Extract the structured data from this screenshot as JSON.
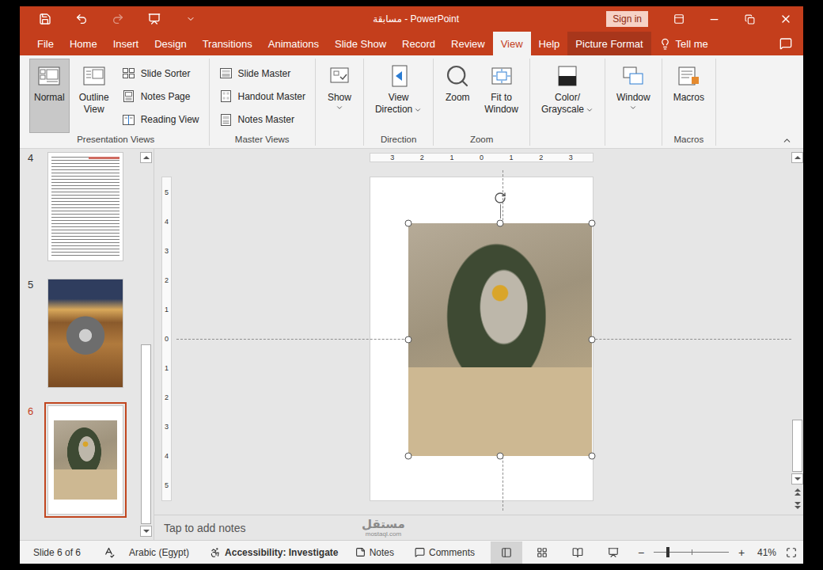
{
  "window": {
    "title": "مسابقة - PowerPoint",
    "sign_in": "Sign in"
  },
  "quick_access": [
    {
      "disabled": false
    },
    {
      "disabled": false
    },
    {
      "disabled": true
    },
    {
      "disabled": false
    },
    {
      "disabled": false
    }
  ],
  "tabs": [
    {
      "label": "File",
      "selected": false,
      "contextual": false
    },
    {
      "label": "Home",
      "selected": false,
      "contextual": false
    },
    {
      "label": "Insert",
      "selected": false,
      "contextual": false
    },
    {
      "label": "Design",
      "selected": false,
      "contextual": false
    },
    {
      "label": "Transitions",
      "selected": false,
      "contextual": false
    },
    {
      "label": "Animations",
      "selected": false,
      "contextual": false
    },
    {
      "label": "Slide Show",
      "selected": false,
      "contextual": false
    },
    {
      "label": "Record",
      "selected": false,
      "contextual": false
    },
    {
      "label": "Review",
      "selected": false,
      "contextual": false
    },
    {
      "label": "View",
      "selected": true,
      "contextual": false
    },
    {
      "label": "Help",
      "selected": false,
      "contextual": false
    },
    {
      "label": "Picture Format",
      "selected": false,
      "contextual": true
    }
  ],
  "tell_me": "Tell me",
  "ribbon": {
    "groups": [
      {
        "label": "Presentation Views",
        "large": [
          {
            "lines": [
              "Normal"
            ],
            "selected": true,
            "dropdown": false
          },
          {
            "lines": [
              "Outline",
              "View"
            ],
            "selected": false,
            "dropdown": false
          }
        ],
        "small": [
          {
            "label": "Slide Sorter"
          },
          {
            "label": "Notes Page"
          },
          {
            "label": "Reading View"
          }
        ]
      },
      {
        "label": "Master Views",
        "large": [],
        "small": [
          {
            "label": "Slide Master"
          },
          {
            "label": "Handout Master"
          },
          {
            "label": "Notes Master"
          }
        ]
      },
      {
        "large": [
          {
            "lines": [
              "Show"
            ],
            "selected": false,
            "dropdown": true
          }
        ],
        "small": []
      },
      {
        "label": "Direction",
        "large": [
          {
            "lines": [
              "View",
              "Direction"
            ],
            "selected": false,
            "dropdown": true
          }
        ],
        "small": []
      },
      {
        "label": "Zoom",
        "large": [
          {
            "lines": [
              "Zoom"
            ],
            "selected": false,
            "dropdown": false
          },
          {
            "lines": [
              "Fit to",
              "Window"
            ],
            "selected": false,
            "dropdown": false
          }
        ],
        "small": []
      },
      {
        "large": [
          {
            "lines": [
              "Color/",
              "Grayscale"
            ],
            "selected": false,
            "dropdown": true
          }
        ],
        "small": []
      },
      {
        "large": [
          {
            "lines": [
              "Window"
            ],
            "selected": false,
            "dropdown": true
          }
        ],
        "small": []
      },
      {
        "label": "Macros",
        "large": [
          {
            "lines": [
              "Macros"
            ],
            "selected": false,
            "dropdown": false
          }
        ],
        "small": []
      }
    ]
  },
  "slides": [
    {
      "number": "4",
      "selected": false,
      "kind": "document"
    },
    {
      "number": "5",
      "selected": false,
      "kind": "photo"
    },
    {
      "number": "6",
      "selected": true,
      "kind": "picture"
    }
  ],
  "thumbnail_scroll": {
    "start": 0.5,
    "size": 0.5
  },
  "editor_scroll": {
    "start": 0.83,
    "size": 0.17
  },
  "editor": {
    "ruler_h": [
      "3",
      "2",
      "1",
      "0",
      "1",
      "2",
      "3"
    ],
    "ruler_v": [
      "5",
      "4",
      "3",
      "2",
      "1",
      "0",
      "1",
      "2",
      "3",
      "4",
      "5"
    ],
    "picture_selected": true
  },
  "notes_placeholder": "Tap to add notes",
  "watermark": {
    "text": "مستقل",
    "url": "mostaql.com"
  },
  "status_bar": {
    "slide": "Slide 6 of 6",
    "language": "Arabic (Egypt)",
    "accessibility": "Accessibility: Investigate",
    "notes": "Notes",
    "comments": "Comments",
    "views": [
      {
        "selected": true
      },
      {
        "selected": false
      },
      {
        "selected": false
      },
      {
        "selected": false
      }
    ],
    "zoom": {
      "minus": "−",
      "plus": "+",
      "level": 0.19,
      "reading": "41%"
    }
  }
}
